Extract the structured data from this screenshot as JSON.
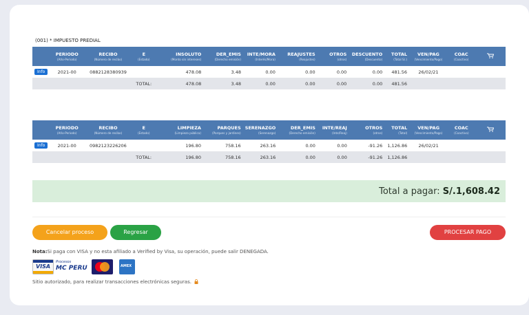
{
  "section_title": "(001) * IMPUESTO PREDIAL",
  "table1": {
    "headers": [
      {
        "label": "PERIODO",
        "sub": "(Año-Periodo)"
      },
      {
        "label": "RECIBO",
        "sub": "(Número de recibo)"
      },
      {
        "label": "E",
        "sub": "(Estado)"
      },
      {
        "label": "INSOLUTO",
        "sub": "(Monto sin intereses)"
      },
      {
        "label": "DER_EMIS",
        "sub": "(Derecho emisión)"
      },
      {
        "label": "INTE/MORA",
        "sub": "(Interés/Mora)"
      },
      {
        "label": "REAJUSTES",
        "sub": "(Reajustes)"
      },
      {
        "label": "OTROS",
        "sub": "(otros)"
      },
      {
        "label": "DESCUENTO",
        "sub": "(Descuento)"
      },
      {
        "label": "TOTAL",
        "sub": "(Total S/.)"
      },
      {
        "label": "VEN/PAG",
        "sub": "(Vencimiento/Pago)"
      },
      {
        "label": "COAC",
        "sub": "(Coactivo)"
      }
    ],
    "row": {
      "info": "Info",
      "periodo": "2021-00",
      "recibo": "0882128380939",
      "estado": "",
      "insoluto": "478.08",
      "der_emis": "3.48",
      "inte_mora": "0.00",
      "reajustes": "0.00",
      "otros": "0.00",
      "descuento": "0.00",
      "total": "481.56",
      "ven_pag": "26/02/21",
      "coac": ""
    },
    "total_row": {
      "label": "TOTAL:",
      "insoluto": "478.08",
      "der_emis": "3.48",
      "inte_mora": "0.00",
      "reajustes": "0.00",
      "otros": "0.00",
      "descuento": "0.00",
      "total": "481.56"
    }
  },
  "table2": {
    "headers": [
      {
        "label": "PERIODO",
        "sub": "(Año-Periodo)"
      },
      {
        "label": "RECIBO",
        "sub": "(Número de recibo)"
      },
      {
        "label": "E",
        "sub": "(Estado)"
      },
      {
        "label": "LIMPIEZA",
        "sub": "(Limpieza pública)"
      },
      {
        "label": "PARQUES",
        "sub": "(Parques y jardines)"
      },
      {
        "label": "SERENAZGO",
        "sub": "(Serenazgo)"
      },
      {
        "label": "DER_EMIS",
        "sub": "(Derecho emisión)"
      },
      {
        "label": "INTE/REAJ",
        "sub": "(Inte/Reaj)"
      },
      {
        "label": "OTROS",
        "sub": "(otros)"
      },
      {
        "label": "TOTAL",
        "sub": "(Total)"
      },
      {
        "label": "VEN/PAG",
        "sub": "(Vencimiento/Pago)"
      },
      {
        "label": "COAC",
        "sub": "(Coactivo)"
      }
    ],
    "row": {
      "info": "Info",
      "periodo": "2021-00",
      "recibo": "0982123226206",
      "estado": "",
      "limpieza": "196.80",
      "parques": "758.16",
      "serenazgo": "263.16",
      "der_emis": "0.00",
      "inte_reaj": "0.00",
      "otros": "-91.26",
      "total": "1,126.86",
      "ven_pag": "26/02/21",
      "coac": ""
    },
    "total_row": {
      "label": "TOTAL:",
      "limpieza": "196.80",
      "parques": "758.16",
      "serenazgo": "263.16",
      "der_emis": "0.00",
      "inte_reaj": "0.00",
      "otros": "-91.26",
      "total": "1,126.86"
    }
  },
  "total_bar": {
    "label": "Total a pagar:",
    "amount": "S/.1,608.42"
  },
  "buttons": {
    "cancel": "Cancelar proceso",
    "back": "Regresar",
    "process": "PROCESAR PAGO"
  },
  "note": {
    "prefix": "Nota:",
    "text": "Si paga con VISA y no esta afiliado a Verified by Visa, su operación, puede salir DENEGADA."
  },
  "payment_logos": {
    "visa": "VISA",
    "mc_line1": "Procesos",
    "mc_line2": "MC PERU",
    "amex": "AMEX"
  },
  "secure_text": "Sitio autorizado, para realizar transacciones electrónicas seguras.",
  "colors": {
    "header_blue": "#4d7ab1",
    "cancel": "#f4a21b",
    "back": "#2aa245",
    "process": "#e14141",
    "total_bg": "#d9eedb"
  }
}
